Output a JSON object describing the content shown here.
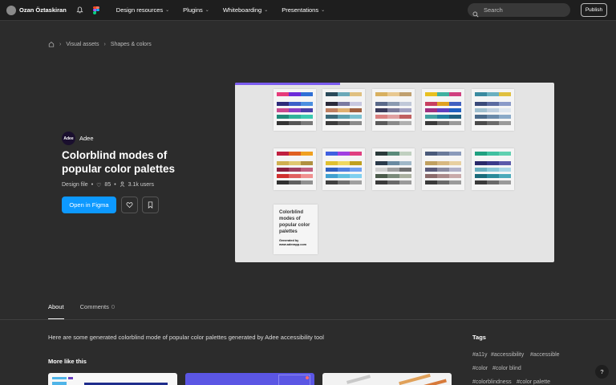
{
  "topbar": {
    "username": "Ozan Öztaskiran",
    "nav": [
      {
        "label": "Design resources"
      },
      {
        "label": "Plugins"
      },
      {
        "label": "Whiteboarding"
      },
      {
        "label": "Presentations"
      }
    ],
    "search_placeholder": "Search",
    "publish_label": "Publish"
  },
  "breadcrumb": {
    "items": [
      "Visual assets",
      "Shapes & colors"
    ]
  },
  "file": {
    "brand_logo_text": "Adee",
    "brand_name": "Adee",
    "title": "Colorblind modes of popular color palettes",
    "type": "Design file",
    "likes": "85",
    "users": "3.1k users",
    "open_label": "Open in Figma"
  },
  "preview": {
    "progress_fraction": 0.33,
    "text_card_title": "Colorblind modes of popular color palettes",
    "text_card_sub": "Generated by www.adeeapp.com"
  },
  "tabs": [
    {
      "label": "About",
      "count": ""
    },
    {
      "label": "Comments",
      "count": "0"
    }
  ],
  "about": {
    "description": "Here are some generated colorblind mode of popular color palettes generated by Adee accessibility tool",
    "more_title": "More like this"
  },
  "tags": {
    "title": "Tags",
    "items": [
      "#a11y",
      "#accessibility",
      "#accessible",
      "#color",
      "#color blind",
      "#colorblindness",
      "#color palette"
    ]
  },
  "help_label": "?",
  "colors": {
    "accent": "#0d99ff",
    "progress": "#7b5cf0",
    "background": "#2c2c2c",
    "topbar": "#1e1e1e"
  }
}
